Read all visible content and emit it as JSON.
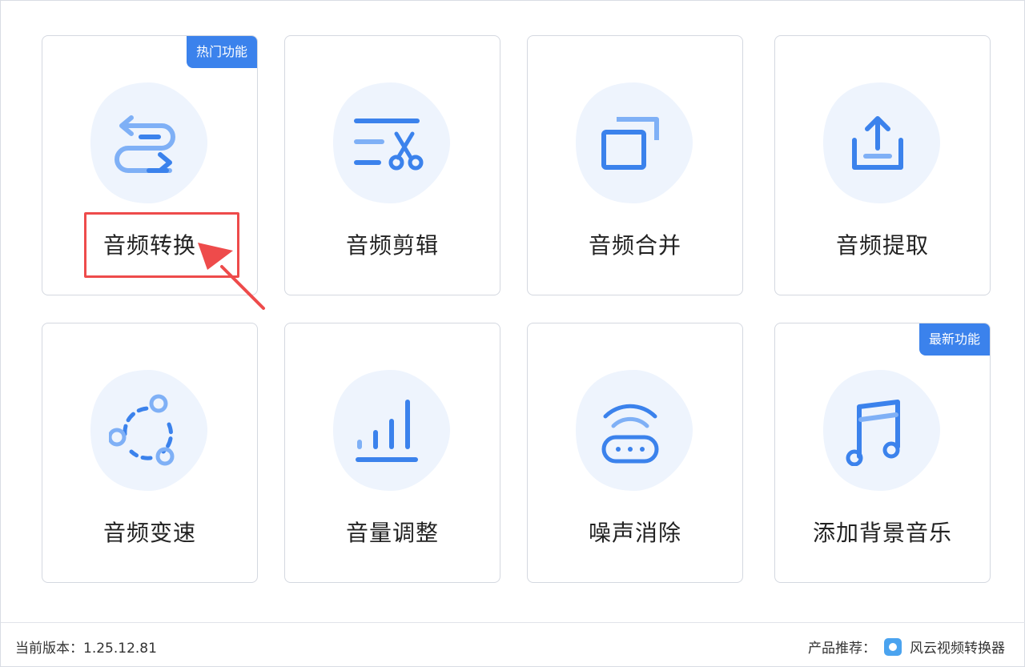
{
  "colors": {
    "accent": "#3b82ec",
    "icon_light": "#7fb0f6",
    "blob": "#eef4fd",
    "annotation": "#ee4b4b"
  },
  "cards": [
    {
      "label": "音频转换",
      "icon": "convert-arrows-icon",
      "badge": "热门功能"
    },
    {
      "label": "音频剪辑",
      "icon": "scissors-icon"
    },
    {
      "label": "音频合并",
      "icon": "merge-squares-icon"
    },
    {
      "label": "音频提取",
      "icon": "upload-tray-icon"
    },
    {
      "label": "音频变速",
      "icon": "speed-cycle-icon"
    },
    {
      "label": "音量调整",
      "icon": "volume-bars-icon"
    },
    {
      "label": "噪声消除",
      "icon": "noise-router-icon"
    },
    {
      "label": "添加背景音乐",
      "icon": "music-note-icon",
      "badge": "最新功能"
    }
  ],
  "footer": {
    "version": "当前版本：1.25.12.81",
    "recommend_label": "产品推荐：",
    "recommend_app": "风云视频转换器",
    "recommend_icon": "app-logo-icon"
  }
}
